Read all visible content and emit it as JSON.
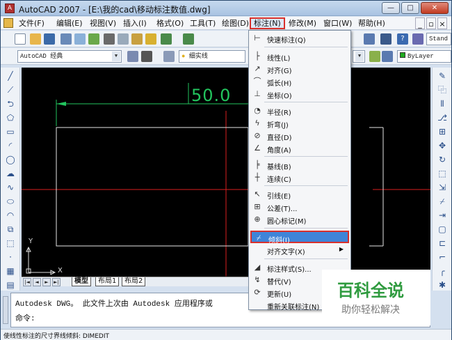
{
  "app": {
    "title": "AutoCAD 2007 - [E:\\我的cad\\移动标注数值.dwg]"
  },
  "window_buttons": [
    "—",
    "□",
    "✕"
  ],
  "menubar": {
    "items": [
      "文件(F)",
      "编辑(E)",
      "视图(V)",
      "插入(I)",
      "格式(O)",
      "工具(T)",
      "绘图(D)",
      "标注(N)",
      "修改(M)",
      "窗口(W)",
      "帮助(H)"
    ],
    "doc_controls": [
      "_",
      "▫",
      "×"
    ]
  },
  "toolbar2": {
    "workspace": "AutoCAD 经典",
    "layer": "细实线",
    "linetype": "ByLayer"
  },
  "toolbar1": {
    "text_style": "Stand"
  },
  "canvas": {
    "dimension_value": "50.0",
    "ucs_x": "X",
    "ucs_y": "Y"
  },
  "layout_tabs": [
    "模型",
    "布局1",
    "布局2"
  ],
  "nav_buttons": [
    "◄◄",
    "◄",
    "►",
    "►►"
  ],
  "command": {
    "line1": "Autodesk DWG。  此文件上次由 Autodesk 应用程序或",
    "line2": "命令:"
  },
  "status": {
    "text": "使线性标注的尺寸界线倾斜:  DIMEDIT"
  },
  "dim_menu": {
    "items": [
      {
        "icon": "quick-dim-icon",
        "label": "快速标注(Q)",
        "glyph": "⊢"
      },
      {
        "icon": "linear-icon",
        "label": "线性(L)",
        "glyph": "├"
      },
      {
        "icon": "aligned-icon",
        "label": "对齐(G)",
        "glyph": "↗"
      },
      {
        "icon": "arc-length-icon",
        "label": "弧长(H)",
        "glyph": "⌒"
      },
      {
        "icon": "ordinate-icon",
        "label": "坐标(O)",
        "glyph": "⊥"
      },
      {
        "icon": "radius-icon",
        "label": "半径(R)",
        "glyph": "◔"
      },
      {
        "icon": "jogged-icon",
        "label": "折弯(J)",
        "glyph": "ϟ"
      },
      {
        "icon": "diameter-icon",
        "label": "直径(D)",
        "glyph": "⊘"
      },
      {
        "icon": "angular-icon",
        "label": "角度(A)",
        "glyph": "∠"
      },
      {
        "icon": "baseline-icon",
        "label": "基线(B)",
        "glyph": "╞"
      },
      {
        "icon": "continue-icon",
        "label": "连续(C)",
        "glyph": "┼"
      },
      {
        "icon": "leader-icon",
        "label": "引线(E)",
        "glyph": "↖"
      },
      {
        "icon": "tolerance-icon",
        "label": "公差(T)...",
        "glyph": "⊞"
      },
      {
        "icon": "center-mark-icon",
        "label": "圆心标记(M)",
        "glyph": "⊕"
      },
      {
        "icon": "oblique-icon",
        "label": "倾斜(I)",
        "glyph": "⌿"
      },
      {
        "icon": "align-text-icon",
        "label": "对齐文字(X)",
        "glyph": ""
      },
      {
        "icon": "dim-style-icon",
        "label": "标注样式(S)...",
        "glyph": "◢"
      },
      {
        "icon": "override-icon",
        "label": "替代(V)",
        "glyph": "↯"
      },
      {
        "icon": "update-icon",
        "label": "更新(U)",
        "glyph": "⟳"
      },
      {
        "icon": "reassociate-icon",
        "label": "重新关联标注(N)",
        "glyph": ""
      }
    ]
  },
  "watermark": {
    "title": "百科全说",
    "subtitle": "助你轻松解决"
  },
  "colors": {
    "dim_green": "#22c55e",
    "axis_red": "#d81e1e",
    "highlight_blue": "#3e84d8",
    "callout_red": "#d8302c"
  }
}
